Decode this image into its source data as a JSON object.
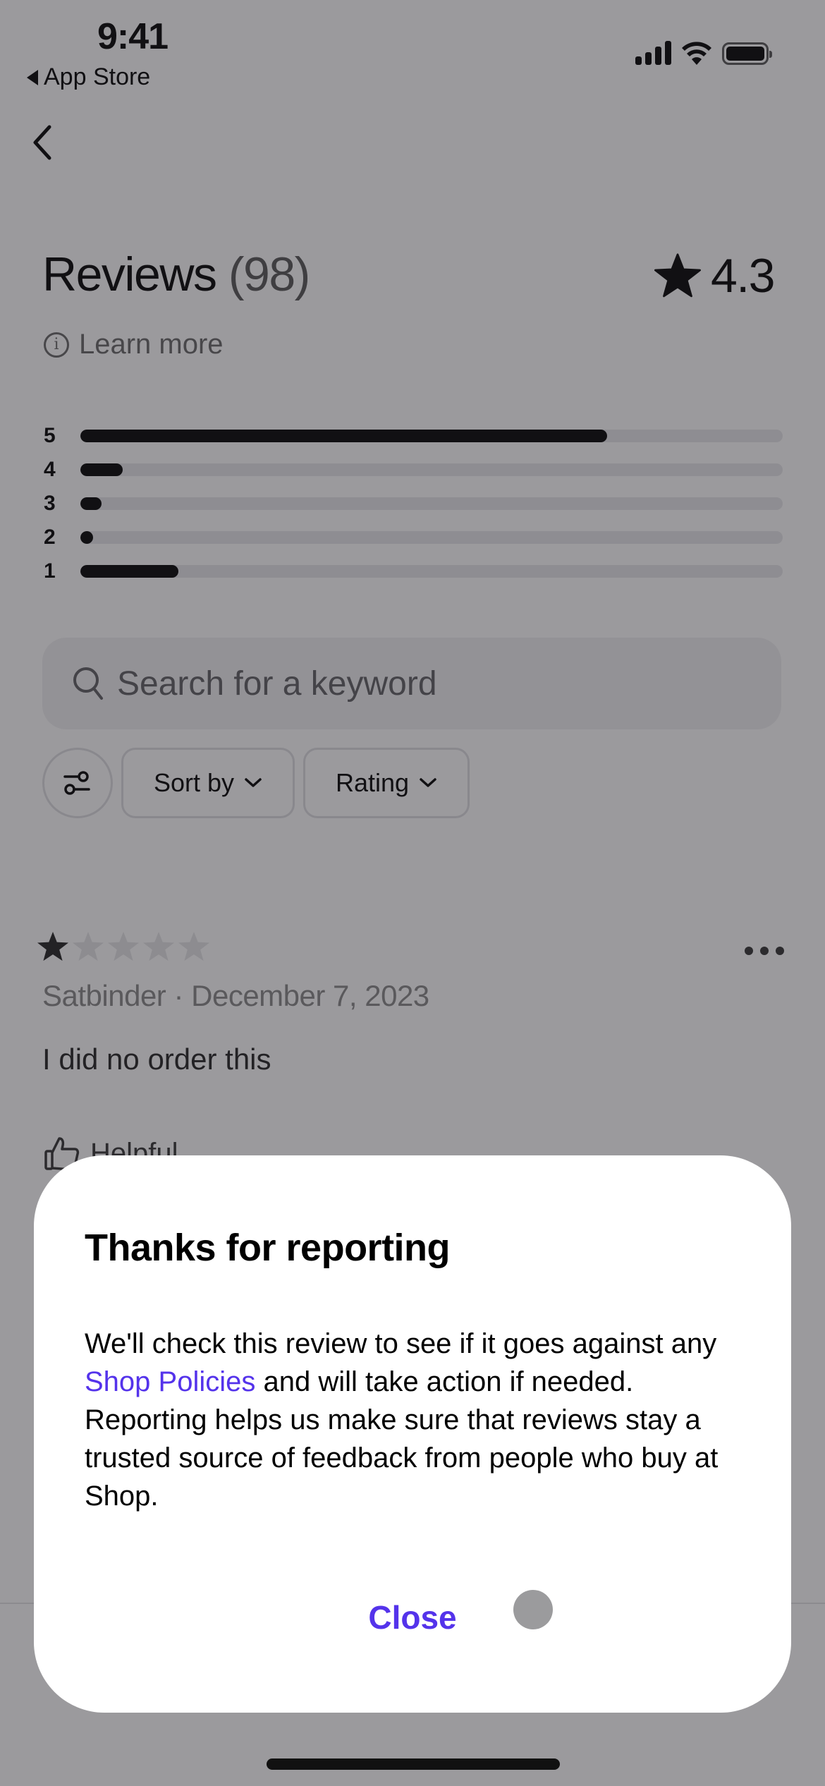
{
  "status_bar": {
    "time": "9:41",
    "back_app": "App Store",
    "icons": [
      "cellular-signal-icon",
      "wifi-icon",
      "battery-icon"
    ]
  },
  "nav": {
    "back_icon": "chevron-left-icon"
  },
  "header": {
    "title": "Reviews",
    "count": "(98)",
    "average_rating": "4.3",
    "rating_icon": "star-icon",
    "learn_more": "Learn more"
  },
  "rating_distribution": [
    {
      "stars": "5",
      "fraction": 0.75
    },
    {
      "stars": "4",
      "fraction": 0.06
    },
    {
      "stars": "3",
      "fraction": 0.03
    },
    {
      "stars": "2",
      "fraction": 0.015
    },
    {
      "stars": "1",
      "fraction": 0.14
    }
  ],
  "search": {
    "placeholder": "Search for a keyword",
    "value": ""
  },
  "filters": {
    "filter_icon": "sliders-icon",
    "sort_label": "Sort by",
    "rating_label": "Rating"
  },
  "review": {
    "rating": 1,
    "max_rating": 5,
    "author": "Satbinder",
    "date": "December 7, 2023",
    "meta_separator": " · ",
    "body": "I did no order this",
    "helpful_label": "Helpful"
  },
  "modal": {
    "title": "Thanks for reporting",
    "body_before_link": "We'll check this review to see if it goes against any ",
    "link_text": "Shop Policies",
    "body_after_link": " and will take action if needed. Reporting helps us make sure that reviews stay a trusted source of feedback from people who buy at Shop.",
    "close_label": "Close"
  },
  "colors": {
    "accent": "#5433eb",
    "overlay": "#9b999c",
    "modal_bg": "#ffffff"
  }
}
